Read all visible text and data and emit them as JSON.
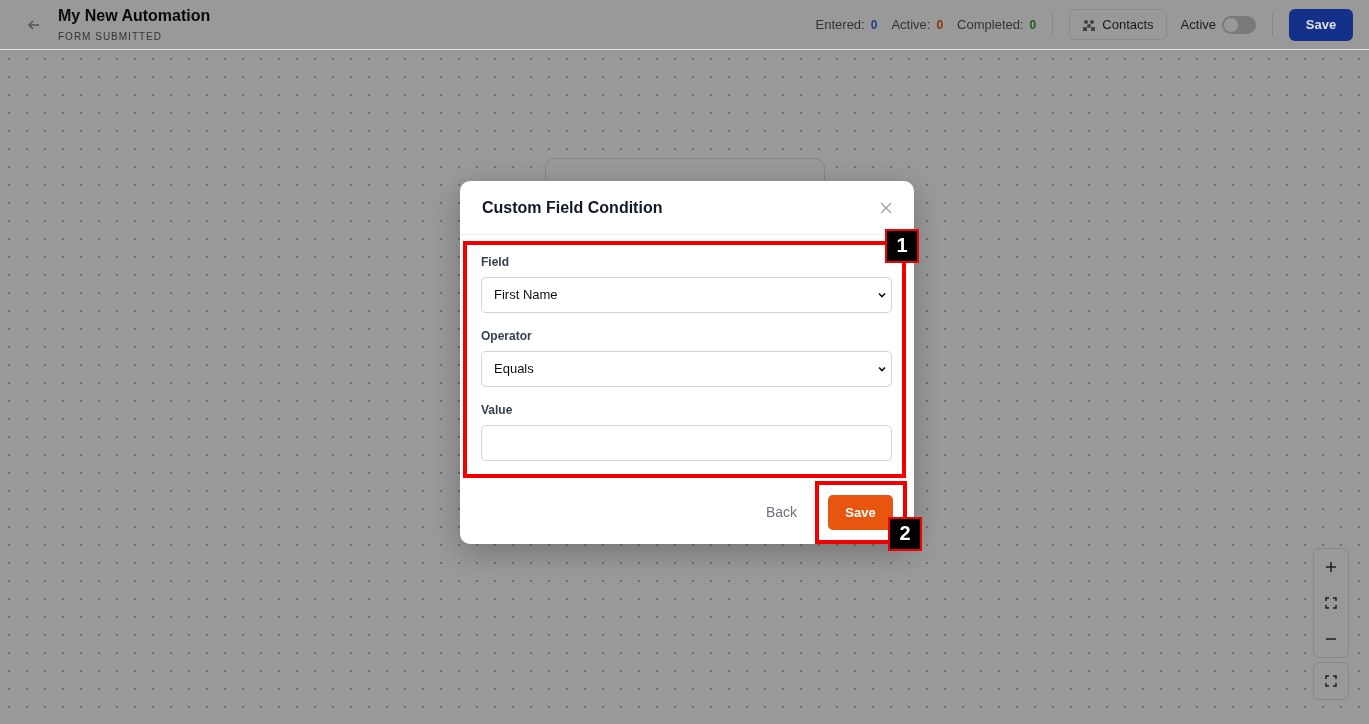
{
  "header": {
    "title": "My New Automation",
    "subtitle": "FORM SUBMITTED",
    "stats": [
      {
        "label": "Entered:",
        "value": "0",
        "color": "#233783"
      },
      {
        "label": "Active:",
        "value": "0",
        "color": "#8b3507"
      },
      {
        "label": "Completed:",
        "value": "0",
        "color": "#1c5f29"
      }
    ],
    "contacts_button": "Contacts",
    "active_label": "Active",
    "active_on": false,
    "save_button": "Save"
  },
  "modal": {
    "title": "Custom Field Condition",
    "fields": [
      {
        "label": "Field",
        "kind": "select",
        "value": "First Name"
      },
      {
        "label": "Operator",
        "kind": "select",
        "value": "Equals"
      },
      {
        "label": "Value",
        "kind": "text"
      }
    ],
    "back_button": "Back",
    "save_button": "Save"
  },
  "annotations": [
    {
      "label": "1"
    },
    {
      "label": "2"
    }
  ]
}
